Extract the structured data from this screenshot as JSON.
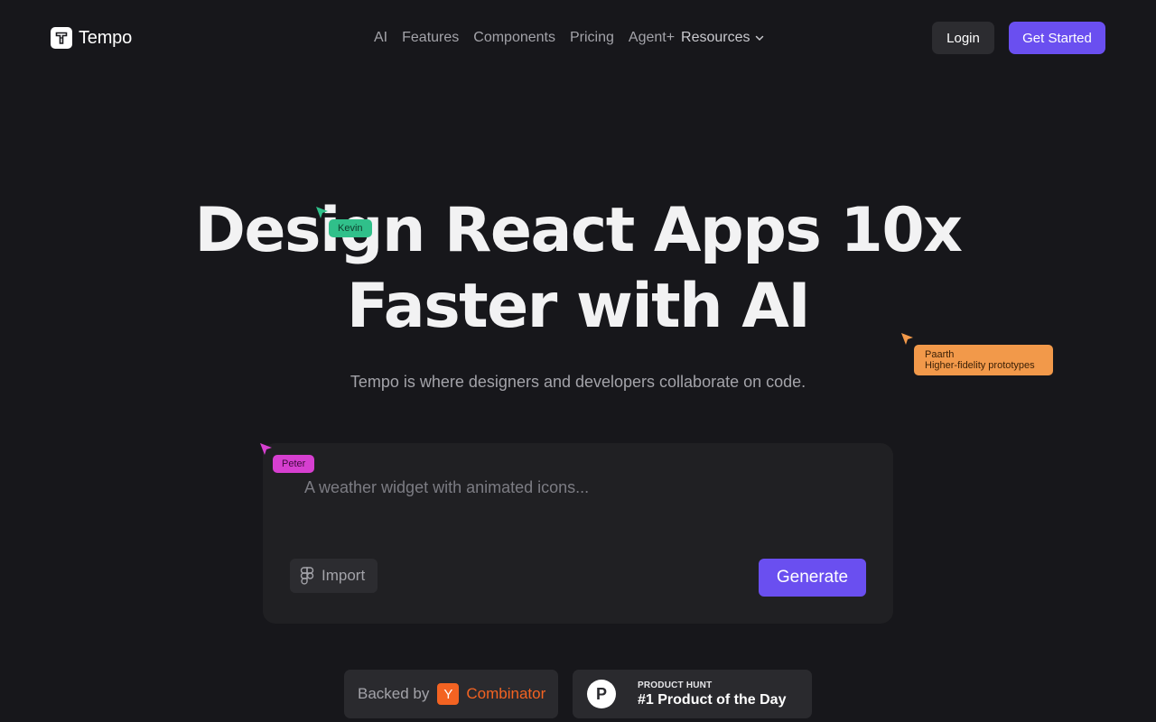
{
  "brand": {
    "name": "Tempo",
    "logo_icon": "tempo-t-logo"
  },
  "nav": {
    "items": [
      {
        "label": "AI"
      },
      {
        "label": "Features"
      },
      {
        "label": "Components"
      },
      {
        "label": "Pricing"
      },
      {
        "label": "Agent+"
      }
    ],
    "resources_label": "Resources",
    "resources_icon": "chevron-down-icon",
    "login_label": "Login",
    "get_started_label": "Get Started"
  },
  "hero": {
    "headline_line1": "Design React Apps 10x",
    "headline_line2": "Faster with AI",
    "subtitle": "Tempo is where designers and developers collaborate on code."
  },
  "cursors": {
    "kevin": {
      "name": "Kevin",
      "color": "#30c08a"
    },
    "peter": {
      "name": "Peter",
      "color": "#d63fd0"
    },
    "paarth": {
      "name": "Paarth",
      "note": "Higher-fidelity prototypes",
      "color": "#f2994a"
    }
  },
  "prompt": {
    "placeholder": "A weather widget with animated icons...",
    "value": "",
    "import_label": "Import",
    "import_icon": "figma-icon",
    "generate_label": "Generate"
  },
  "badges": {
    "yc": {
      "prefix": "Backed by",
      "logo_letter": "Y",
      "name": "Combinator"
    },
    "product_hunt": {
      "logo_letter": "P",
      "kicker": "PRODUCT HUNT",
      "title": "#1 Product of the Day"
    }
  },
  "colors": {
    "background": "#17171b",
    "accent": "#6a4ff0",
    "yc_orange": "#f36322"
  }
}
